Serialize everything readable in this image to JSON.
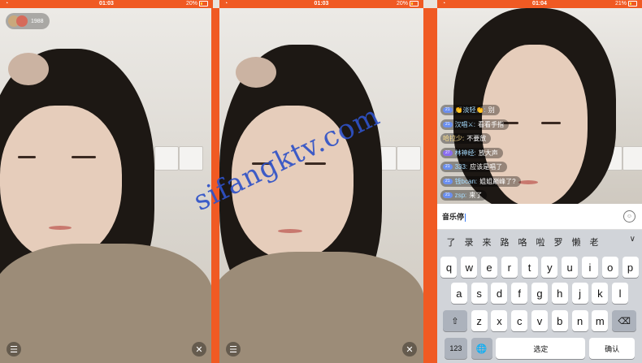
{
  "panels": [
    {
      "status": {
        "time": "01:03",
        "battery": "20%"
      },
      "host": {
        "name": "1988"
      }
    },
    {
      "status": {
        "time": "01:03",
        "battery": "20%"
      }
    },
    {
      "status": {
        "time": "01:04",
        "battery": "21%"
      },
      "chat": [
        {
          "level": "21",
          "user": "👏淡轻👏:",
          "text": "别"
        },
        {
          "level": "21",
          "user": "汉唱⚔:",
          "text": "看看手指"
        },
        {
          "level": "",
          "user": "哈拉少:",
          "text": "不要放"
        },
        {
          "level": "27",
          "user": "林神经:",
          "text": "放大声"
        },
        {
          "level": "21",
          "user": "333:",
          "text": "应该是唱了"
        },
        {
          "level": "21",
          "user": "钱bcan:",
          "text": "姐姐巅峰了?"
        },
        {
          "level": "21",
          "user": "zsp:",
          "text": "来了"
        }
      ],
      "input": {
        "value": "音乐停"
      },
      "keyboard": {
        "candidates": [
          "了",
          "录",
          "来",
          "路",
          "咯",
          "啦",
          "罗",
          "懒",
          "老"
        ],
        "row1": [
          "q",
          "w",
          "e",
          "r",
          "t",
          "y",
          "u",
          "i",
          "o",
          "p"
        ],
        "row2": [
          "a",
          "s",
          "d",
          "f",
          "g",
          "h",
          "j",
          "k",
          "l"
        ],
        "row3": [
          "z",
          "x",
          "c",
          "v",
          "b",
          "n",
          "m"
        ],
        "num_label": "123",
        "space_label": "选定",
        "enter_label": "确认"
      }
    }
  ],
  "watermark": "sifangktv.com",
  "colors": {
    "status_bar": "#f05a23",
    "keyboard_bg": "#d1d4d9"
  }
}
